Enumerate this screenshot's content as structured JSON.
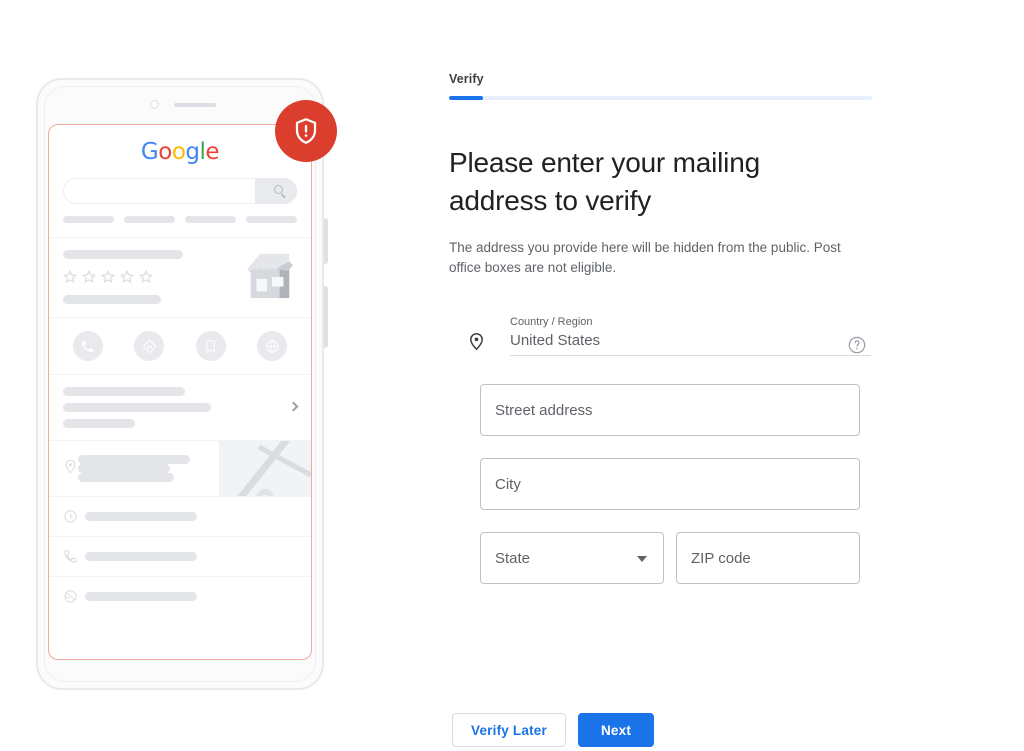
{
  "stepper": {
    "tab_label": "Verify",
    "progress_percent": 8,
    "accent_color": "#1a73e8",
    "track_color": "#e8f0fe"
  },
  "main": {
    "headline": "Please enter your mailing address to verify",
    "description": "The address you provide here will be hidden from the public. Post office boxes are not eligible."
  },
  "form": {
    "country": {
      "label": "Country / Region",
      "value": "United States",
      "pin_icon": "location-pin-icon",
      "help_icon": "help-circle-icon"
    },
    "street": {
      "placeholder": "Street address",
      "value": ""
    },
    "city": {
      "placeholder": "City",
      "value": ""
    },
    "state": {
      "placeholder": "State",
      "value": "",
      "caret_icon": "chevron-down-icon"
    },
    "zip": {
      "placeholder": "ZIP code",
      "value": ""
    }
  },
  "actions": {
    "verify_later": "Verify Later",
    "next": "Next"
  },
  "illustration": {
    "logo": {
      "letters": [
        "G",
        "o",
        "o",
        "g",
        "l",
        "e"
      ],
      "colors": [
        "#4285f4",
        "#ea4335",
        "#fbbc05",
        "#4285f4",
        "#34a853",
        "#ea4335"
      ]
    },
    "badge": {
      "icon": "shield-alert-icon",
      "color": "#db3e2c"
    },
    "screen_border_color": "#f2a9a0",
    "search_icon": "search-icon",
    "rating_stars": 5,
    "action_icons": [
      "phone-icon",
      "directions-icon",
      "bookmark-icon",
      "globe-icon"
    ],
    "row_icons": [
      "location-pin-icon",
      "clock-icon",
      "phone-icon",
      "globe-icon"
    ],
    "chevron_icon": "chevron-right-icon",
    "storefront_icon": "storefront-icon",
    "map_pin_icon": "map-pin-icon"
  }
}
